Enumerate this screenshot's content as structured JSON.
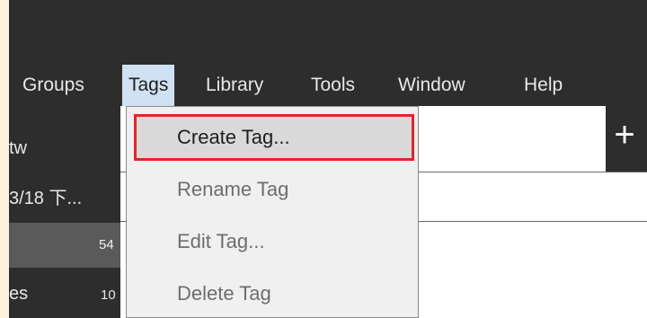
{
  "menubar": {
    "items": [
      "Groups",
      "Tags",
      "Library",
      "Tools",
      "Window",
      "Help"
    ],
    "active": "Tags"
  },
  "left_panel": {
    "row1_text": "tw",
    "row2_text": "3/18 下...",
    "row3_count": "54",
    "row4_text": "es",
    "row4_count": "10"
  },
  "tags_menu": {
    "items": [
      {
        "label": "Create Tag...",
        "enabled": true,
        "highlighted": true
      },
      {
        "label": "Rename Tag",
        "enabled": false
      },
      {
        "label": "Edit Tag...",
        "enabled": false
      },
      {
        "label": "Delete Tag",
        "enabled": false
      }
    ]
  },
  "main": {
    "add_tab_symbol": "+"
  },
  "colors": {
    "background": "#2d2d2d",
    "menu_active": "#cfe1f2",
    "highlight_border": "#e0262b",
    "outer_frame": "#fdf3df"
  }
}
